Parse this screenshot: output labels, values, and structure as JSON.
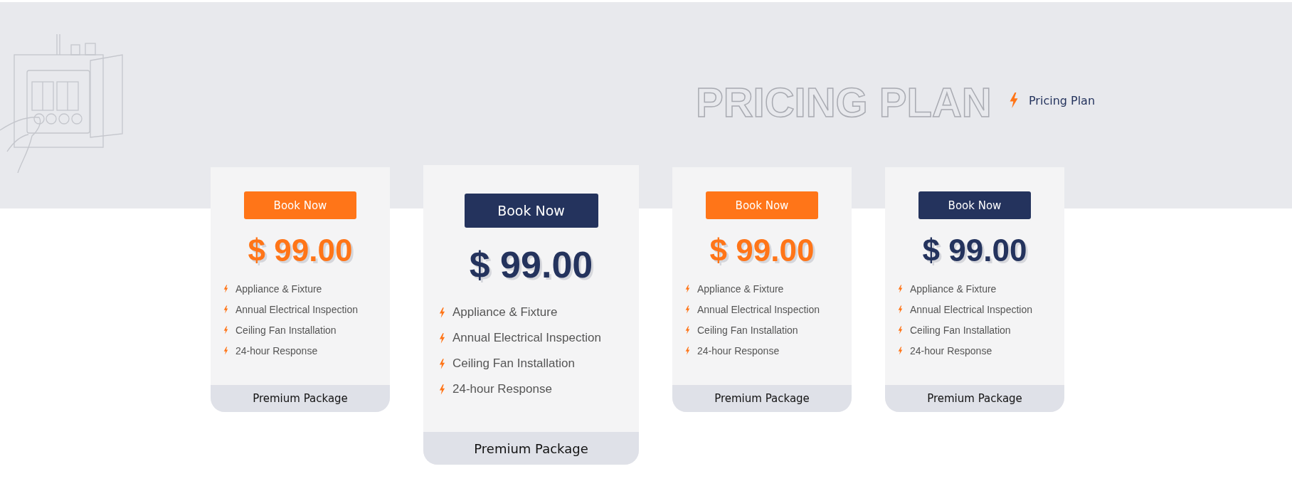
{
  "header": {
    "title": "PRICING PLAN",
    "breadcrumb": "Pricing Plan"
  },
  "plans": [
    {
      "featured": false,
      "color": "#ff7518",
      "button": "Book Now",
      "price": "$ 99.00",
      "features": [
        "Appliance & Fixture",
        "Annual Electrical Inspection",
        "Ceiling Fan Installation",
        "24-hour Response"
      ],
      "footer": "Premium Package"
    },
    {
      "featured": true,
      "color": "#24335d",
      "button": "Book Now",
      "price": "$ 99.00",
      "features": [
        "Appliance & Fixture",
        "Annual Electrical Inspection",
        "Ceiling Fan Installation",
        "24-hour Response"
      ],
      "footer": "Premium Package"
    },
    {
      "featured": false,
      "color": "#ff7518",
      "button": "Book Now",
      "price": "$ 99.00",
      "features": [
        "Appliance & Fixture",
        "Annual Electrical Inspection",
        "Ceiling Fan Installation",
        "24-hour Response"
      ],
      "footer": "Premium Package"
    },
    {
      "featured": false,
      "color": "#24335d",
      "button": "Book Now",
      "price": "$ 99.00",
      "features": [
        "Appliance & Fixture",
        "Annual Electrical Inspection",
        "Ceiling Fan Installation",
        "24-hour Response"
      ],
      "footer": "Premium Package"
    }
  ]
}
